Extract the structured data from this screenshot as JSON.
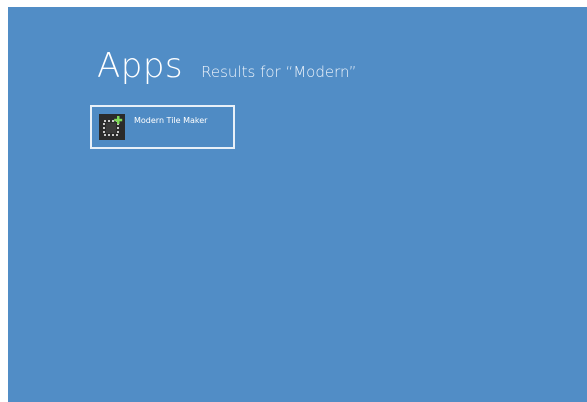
{
  "colors": {
    "background": "#518dc6",
    "tile_border": "#e8f0f8",
    "icon_bg": "#2b2b2b",
    "icon_accent": "#7ed957"
  },
  "header": {
    "title": "Apps",
    "subtitle": "Results for “Modern”"
  },
  "results": [
    {
      "name": "Modern Tile Maker",
      "icon": "tile-maker-icon"
    }
  ]
}
